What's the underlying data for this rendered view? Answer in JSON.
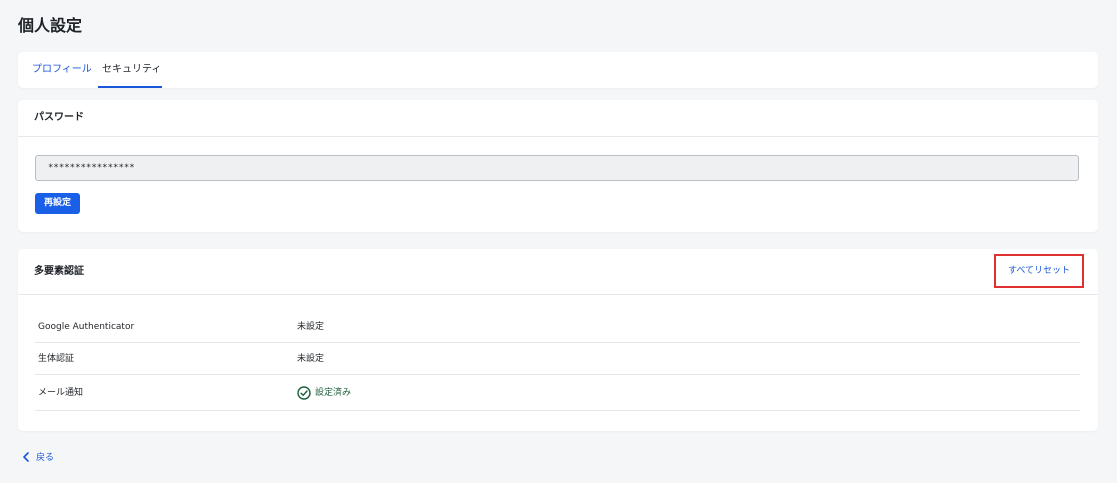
{
  "page": {
    "title": "個人設定"
  },
  "tabs": [
    {
      "label": "プロフィール",
      "active": false
    },
    {
      "label": "セキュリティ",
      "active": true
    }
  ],
  "password": {
    "heading": "パスワード",
    "value": "****************",
    "reset_button": "再設定"
  },
  "mfa": {
    "heading": "多要素認証",
    "reset_all": "すべてリセット",
    "rows": [
      {
        "name": "Google Authenticator",
        "status": "未設定"
      },
      {
        "name": "生体認証",
        "status": "未設定"
      },
      {
        "name": "メール通知",
        "status": "設定済み",
        "icon": "check-circle-icon"
      }
    ]
  },
  "footer": {
    "back": "戻る",
    "icon": "chevron-left-icon"
  },
  "colors": {
    "accent": "#1a5fe8",
    "link": "#1a56db",
    "success": "#1b5e3b",
    "highlight": "#e03030"
  }
}
